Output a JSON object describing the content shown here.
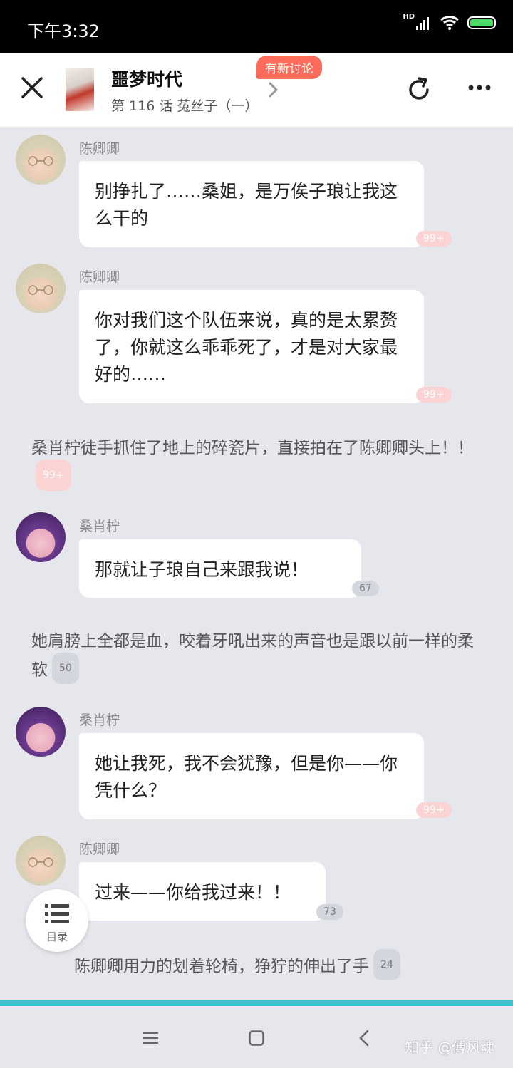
{
  "status": {
    "time": "下午3:32",
    "network": "HD"
  },
  "header": {
    "title": "噩梦时代",
    "subtitle": "第 116 话 菟丝子（一）",
    "new_discussion": "有新讨论"
  },
  "messages": [
    {
      "name": "陈卿卿",
      "text": "别挣扎了……桑姐，是万俟子琅让我这么干的",
      "count": "99+"
    },
    {
      "name": "陈卿卿",
      "text": "你对我们这个队伍来说，真的是太累赘了，你就这么乖乖死了，才是对大家最好的……",
      "count": "99+"
    },
    {
      "narration": "桑肖柠徒手抓住了地上的碎瓷片，直接拍在了陈卿卿头上！！",
      "count": "99+"
    },
    {
      "name": "桑肖柠",
      "text": "那就让子琅自己来跟我说！",
      "count": "67"
    },
    {
      "narration": "她肩膀上全都是血，咬着牙吼出来的声音也是跟以前一样的柔软",
      "count": "50"
    },
    {
      "name": "桑肖柠",
      "text": "她让我死，我不会犹豫，但是你——你凭什么？",
      "count": "99+"
    },
    {
      "name": "陈卿卿",
      "text": "过来——你给我过来！！",
      "count": "73"
    },
    {
      "narration": "陈卿卿用力的划着轮椅，狰狞的伸出了手",
      "count": "24"
    }
  ],
  "catalog": {
    "label": "目录"
  },
  "watermark": "知乎 @傅风魂",
  "colors": {
    "accent": "#3cc3cf",
    "badge": "#ff6b5a",
    "hot_count": "#fbd3d3"
  }
}
